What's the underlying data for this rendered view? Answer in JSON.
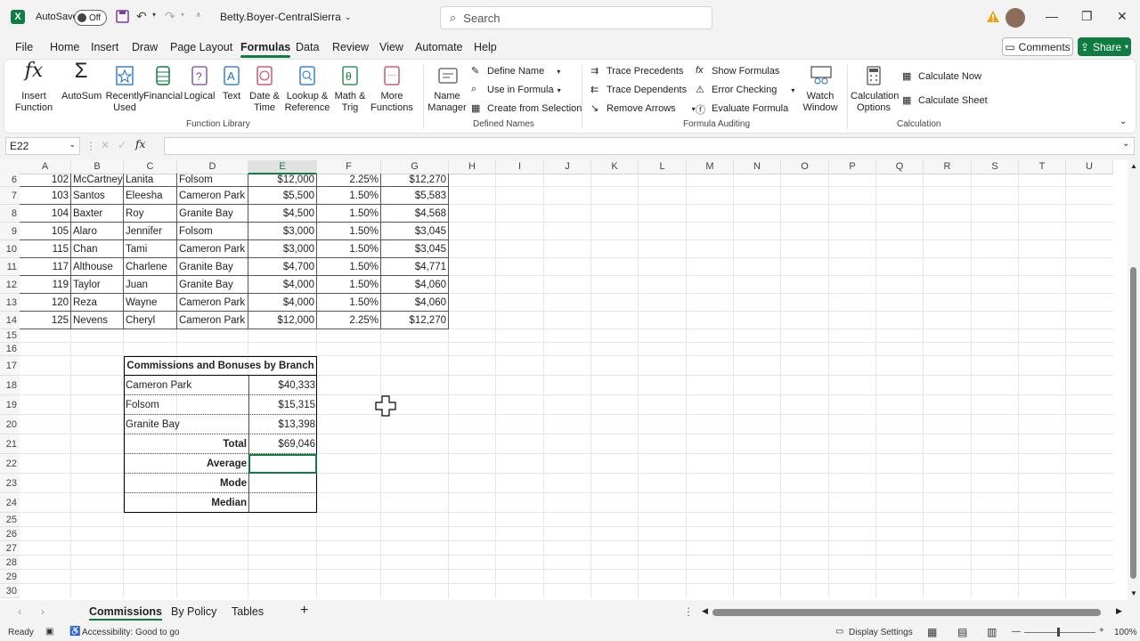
{
  "titlebar": {
    "autosave_label": "AutoSave",
    "autosave_state": "Off",
    "file_name": "Betty.Boyer-CentralSierra",
    "search_placeholder": "Search"
  },
  "tabs": [
    "File",
    "Home",
    "Insert",
    "Draw",
    "Page Layout",
    "Formulas",
    "Data",
    "Review",
    "View",
    "Automate",
    "Help"
  ],
  "active_tab": "Formulas",
  "comments_label": "Comments",
  "share_label": "Share",
  "ribbon": {
    "insert_function": "Insert Function",
    "autosum": "AutoSum",
    "recently_used": "Recently Used",
    "financial": "Financial",
    "logical": "Logical",
    "text": "Text",
    "date_time": "Date & Time",
    "lookup": "Lookup & Reference",
    "math_trig": "Math & Trig",
    "more_functions": "More Functions",
    "function_library": "Function Library",
    "name_manager": "Name Manager",
    "define_name": "Define Name",
    "use_in_formula": "Use in Formula",
    "create_from_selection": "Create from Selection",
    "defined_names": "Defined Names",
    "trace_precedents": "Trace Precedents",
    "trace_dependents": "Trace Dependents",
    "remove_arrows": "Remove Arrows",
    "show_formulas": "Show Formulas",
    "error_checking": "Error Checking",
    "evaluate_formula": "Evaluate Formula",
    "formula_auditing": "Formula Auditing",
    "watch_window": "Watch Window",
    "calculation_options": "Calculation Options",
    "calculate_now": "Calculate Now",
    "calculate_sheet": "Calculate Sheet",
    "calculation": "Calculation"
  },
  "formula_bar": {
    "name_box": "E22",
    "fx": "fx"
  },
  "columns": [
    "A",
    "B",
    "C",
    "D",
    "E",
    "F",
    "G",
    "H",
    "I",
    "J",
    "K",
    "L",
    "M",
    "N",
    "O",
    "P",
    "Q",
    "R",
    "S",
    "T",
    "U"
  ],
  "rows": [
    "6",
    "7",
    "8",
    "9",
    "10",
    "11",
    "12",
    "13",
    "14",
    "15",
    "16",
    "17",
    "18",
    "19",
    "20",
    "21",
    "22",
    "23",
    "24",
    "25",
    "26",
    "27",
    "28",
    "29",
    "30"
  ],
  "data_rows": [
    {
      "a": "102",
      "b": "McCartney",
      "c": "Lanita",
      "d": "Folsom",
      "e": "$12,000",
      "f": "2.25%",
      "g": "$12,270"
    },
    {
      "a": "103",
      "b": "Santos",
      "c": "Eleesha",
      "d": "Cameron Park",
      "e": "$5,500",
      "f": "1.50%",
      "g": "$5,583"
    },
    {
      "a": "104",
      "b": "Baxter",
      "c": "Roy",
      "d": "Granite Bay",
      "e": "$4,500",
      "f": "1.50%",
      "g": "$4,568"
    },
    {
      "a": "105",
      "b": "Alaro",
      "c": "Jennifer",
      "d": "Folsom",
      "e": "$3,000",
      "f": "1.50%",
      "g": "$3,045"
    },
    {
      "a": "115",
      "b": "Chan",
      "c": "Tami",
      "d": "Cameron Park",
      "e": "$3,000",
      "f": "1.50%",
      "g": "$3,045"
    },
    {
      "a": "117",
      "b": "Althouse",
      "c": "Charlene",
      "d": "Granite Bay",
      "e": "$4,700",
      "f": "1.50%",
      "g": "$4,771"
    },
    {
      "a": "119",
      "b": "Taylor",
      "c": "Juan",
      "d": "Granite Bay",
      "e": "$4,000",
      "f": "1.50%",
      "g": "$4,060"
    },
    {
      "a": "120",
      "b": "Reza",
      "c": "Wayne",
      "d": "Cameron Park",
      "e": "$4,000",
      "f": "1.50%",
      "g": "$4,060"
    },
    {
      "a": "125",
      "b": "Nevens",
      "c": "Cheryl",
      "d": "Cameron Park",
      "e": "$12,000",
      "f": "2.25%",
      "g": "$12,270"
    }
  ],
  "summary": {
    "title": "Commissions and Bonuses by Branch",
    "branches": [
      {
        "name": "Cameron Park",
        "value": "$40,333"
      },
      {
        "name": "Folsom",
        "value": "$15,315"
      },
      {
        "name": "Granite Bay",
        "value": "$13,398"
      }
    ],
    "total_label": "Total",
    "total_value": "$69,046",
    "average_label": "Average",
    "mode_label": "Mode",
    "median_label": "Median"
  },
  "sheets": [
    "Commissions",
    "By Policy",
    "Tables"
  ],
  "active_sheet": "Commissions",
  "status": {
    "ready": "Ready",
    "accessibility": "Accessibility: Good to go",
    "display_settings": "Display Settings",
    "zoom": "100%"
  }
}
